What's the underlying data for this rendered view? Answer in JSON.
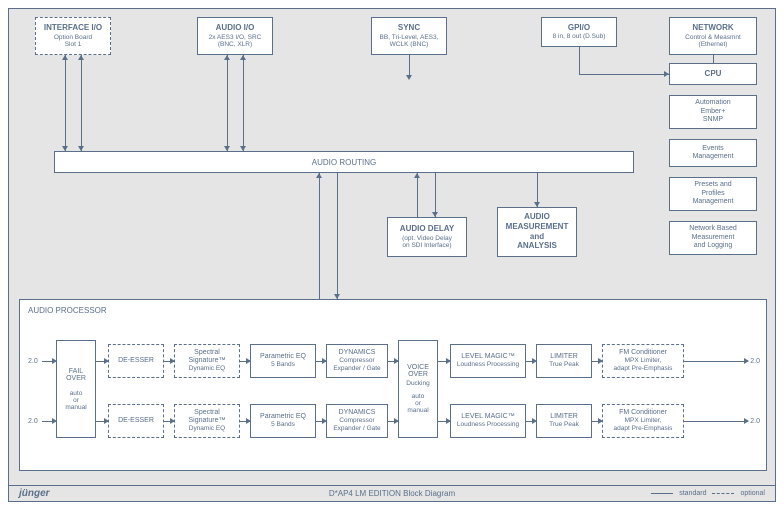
{
  "top": {
    "interface": {
      "title": "INTERFACE I/O",
      "sub": "Option Board\nSlot 1"
    },
    "audio": {
      "title": "AUDIO I/O",
      "sub": "2x AES3 I/O, SRC\n(BNC, XLR)"
    },
    "sync": {
      "title": "SYNC",
      "sub": "BB, Tri-Level, AES3,\nWCLK (BNC)"
    },
    "gpio": {
      "title": "GPI/O",
      "sub": "8 in, 8 out (D.Sub)"
    },
    "network": {
      "title": "NETWORK",
      "sub": "Control & Measmnt\n(Ethernet)"
    }
  },
  "side": {
    "cpu": "CPU",
    "auto": "Automation\nEmber+\nSNMP",
    "events": "Events\nManagement",
    "presets": "Presets and\nProfiles\nManagement",
    "netlog": "Network Based\nMeasurement\nand Logging"
  },
  "routing": "AUDIO ROUTING",
  "mid": {
    "delay": {
      "title": "AUDIO DELAY",
      "sub": "(opt. Video Delay\non SDI Interface)"
    },
    "meas": {
      "title": "AUDIO\nMEASUREMENT\nand\nANALYSIS"
    }
  },
  "processor": {
    "label": "AUDIO PROCESSOR",
    "io": "2.0",
    "failover": {
      "title": "FAIL\nOVER",
      "sub": "auto\nor\nmanual"
    },
    "voiceover": {
      "title": "VOICE\nOVER",
      "sub": "Ducking",
      "sub2": "auto\nor\nmanual"
    },
    "chain": {
      "deesser": {
        "title": "DE-ESSER"
      },
      "spectral": {
        "title": "Spectral\nSignature™",
        "sub": "Dynamic EQ"
      },
      "peq": {
        "title": "Parametric EQ",
        "sub": "5 Bands"
      },
      "dyn": {
        "title": "DYNAMICS",
        "sub": "Compressor\nExpander / Gate"
      },
      "level": {
        "title": "LEVEL MAGIC™",
        "sub": "Loudness Processing"
      },
      "limiter": {
        "title": "LIMITER",
        "sub": "True Peak"
      },
      "fm": {
        "title": "FM Conditioner",
        "sub": "MPX Limiter,\nadapt Pre-Emphasis"
      }
    }
  },
  "footer": {
    "brand": "jünger",
    "title": "D*AP4 LM EDITION Block Diagram",
    "standard": "standard",
    "optional": "optional"
  }
}
